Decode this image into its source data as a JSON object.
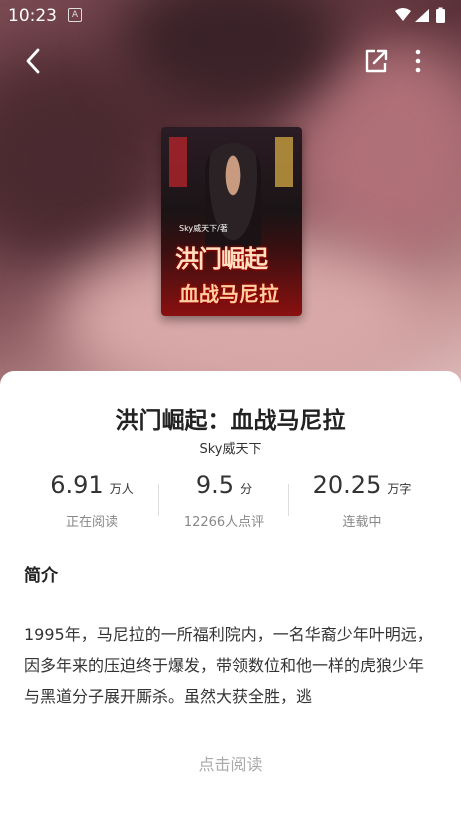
{
  "status_bar": {
    "time": "10:23",
    "notif_icon": "A"
  },
  "book": {
    "title": "洪门崛起：血战马尼拉",
    "author": "Sky威天下",
    "cover": {
      "author_text": "Sky威天下/著",
      "title_line1": "洪门崛起",
      "title_line2": "血战马尼拉"
    }
  },
  "stats": [
    {
      "value": "6.91",
      "unit": "万人",
      "label": "正在阅读"
    },
    {
      "value": "9.5",
      "unit": "分",
      "label": "12266人点评"
    },
    {
      "value": "20.25",
      "unit": "万字",
      "label": "连载中"
    }
  ],
  "intro": {
    "heading": "简介",
    "text": "1995年，马尼拉的一所福利院内，一名华裔少年叶明远，因多年来的压迫终于爆发，带领数位和他一样的虎狼少年与黑道分子展开厮杀。虽然大获全胜，逃"
  },
  "read_button": "点击阅读",
  "icons": {
    "back": "back-arrow-icon",
    "share": "share-icon",
    "more": "more-vertical-icon"
  }
}
